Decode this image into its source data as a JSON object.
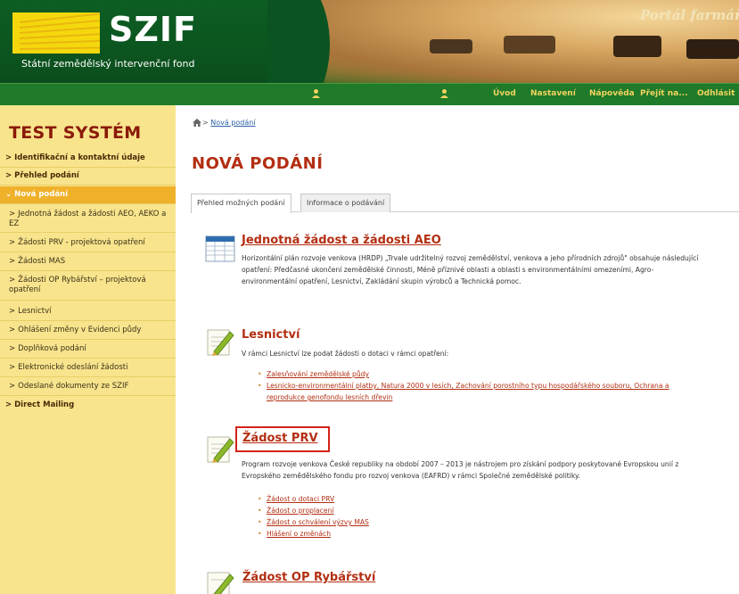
{
  "header": {
    "logo_text": "SZIF",
    "logo_subtitle": "Státní zemědělský intervenční fond",
    "portal_title": "Portál farmáře",
    "colors": {
      "green": "#0d5a1d",
      "yellow": "#f4d80d",
      "accent_red": "#b32e12"
    }
  },
  "nav": {
    "icons": [
      "user-icon",
      "user-icon"
    ],
    "items": [
      "Úvod",
      "Nastavení",
      "Nápověda",
      "Přejít na...",
      "Odhlásit"
    ]
  },
  "sidebar": {
    "system_title": "TEST SYSTÉM",
    "items": [
      {
        "label": "Identifikační a kontaktní údaje",
        "level": "top"
      },
      {
        "label": "Přehled podání",
        "level": "top"
      },
      {
        "label": "Nová podání",
        "level": "top",
        "active": true
      },
      {
        "label": "Jednotná žádost a žádosti AEO, AEKO a EZ",
        "level": "sub"
      },
      {
        "label": "Žádosti PRV - projektová opatření",
        "level": "sub"
      },
      {
        "label": "Žádosti MAS",
        "level": "sub"
      },
      {
        "label": "Žádosti OP Rybářství – projektová opatření",
        "level": "sub"
      },
      {
        "label": "Lesnictví",
        "level": "sub"
      },
      {
        "label": "Ohlášení změny v Evidenci půdy",
        "level": "sub"
      },
      {
        "label": "Doplňková podání",
        "level": "sub"
      },
      {
        "label": "Elektronické odeslání žádosti",
        "level": "sub"
      },
      {
        "label": "Odeslané dokumenty ze SZIF",
        "level": "sub"
      },
      {
        "label": "Direct Mailing",
        "level": "top"
      }
    ]
  },
  "main": {
    "breadcrumb": {
      "separator": ">",
      "current": "Nová podání"
    },
    "page_title": "NOVÁ PODÁNÍ",
    "tabs": [
      {
        "label": "Přehled možných podání",
        "active": true
      },
      {
        "label": "Informace o podávání",
        "active": false
      }
    ],
    "sections": [
      {
        "icon": "table-icon",
        "title": "Jednotná žádost a žádosti AEO",
        "desc_lines": [
          "Horizontální plán rozvoje venkova (HRDP) „Trvale udržitelný rozvoj zemědělství, venkova a jeho přírodních zdrojů\" obsahuje následující",
          "opatření: Předčasné ukončení zemědělské činnosti, Méně příznivé oblasti a oblasti s environmentálními omezeními, Agro-",
          "environmentální opatření, Lesnictví, Zakládání skupin výrobců a Technická pomoc."
        ],
        "links": []
      },
      {
        "icon": "edit-form-icon",
        "title": "Lesnictví",
        "desc_lines": [
          "V rámci Lesnictví lze podat žádosti o dotaci v rámci opatření:"
        ],
        "links": [
          [
            "Zalesňování zemědělské půdy"
          ],
          [
            "Lesnicko-environmentální platby, Natura 2000 v lesích, Zachování porostního typu hospodářského souboru, Ochrana a",
            "reprodukce genofondu lesních dřevin"
          ]
        ]
      },
      {
        "icon": "edit-form-icon",
        "title": "Žádost PRV",
        "highlighted": true,
        "desc_lines": [
          "Program rozvoje venkova České republiky na období 2007 – 2013 je nástrojem pro získání podpory poskytované Evropskou unií z",
          "Evropského zemědělského fondu pro rozvoj venkova (EAFRD) v rámci Společné zemědělské politiky."
        ],
        "links": [
          [
            "Žádost o dotaci PRV"
          ],
          [
            "Žádost o proplacení"
          ],
          [
            "Žádost o schválení výzvy MAS"
          ],
          [
            "Hlášení o změnách"
          ]
        ]
      },
      {
        "icon": "edit-form-icon",
        "title": "Žádost OP Rybářství",
        "desc_lines": [],
        "links": []
      }
    ]
  }
}
